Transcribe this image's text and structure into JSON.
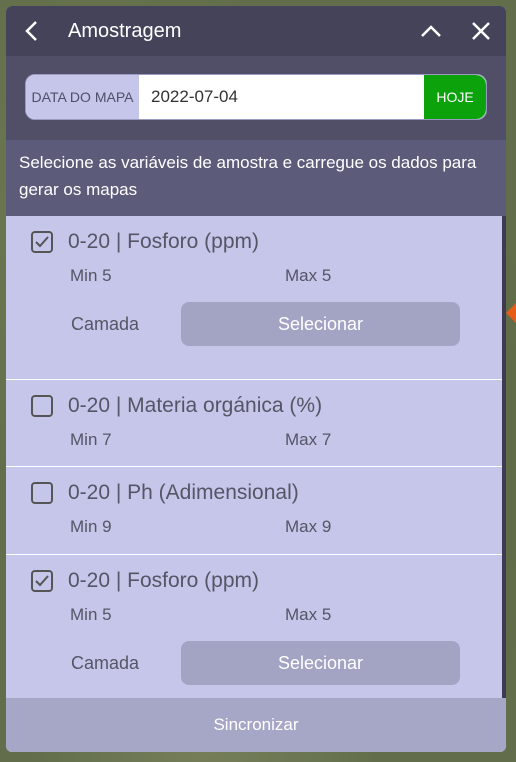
{
  "header": {
    "title": "Amostragem",
    "back_icon": "chevron-left-icon",
    "collapse_icon": "chevron-up-icon",
    "close_icon": "close-icon"
  },
  "date": {
    "label": "DATA DO MAPA",
    "value": "2022-07-04",
    "today_label": "HOJE"
  },
  "instructions": "Selecione as variáveis de amostra e carregue os dados para gerar os mapas",
  "items": [
    {
      "name": "0-20 | Fosforo (ppm)",
      "min": "Min 5",
      "max": "Max 5",
      "checked": true,
      "layer_label": "Camada",
      "select_label": "Selecionar"
    },
    {
      "name": "0-20 | Materia orgánica (%)",
      "min": "Min 7",
      "max": "Max 7",
      "checked": false
    },
    {
      "name": "0-20 | Ph (Adimensional)",
      "min": "Min 9",
      "max": "Max 9",
      "checked": false
    },
    {
      "name": "0-20 | Fosforo (ppm)",
      "min": "Min 5",
      "max": "Max 5",
      "checked": true,
      "layer_label": "Camada",
      "select_label": "Selecionar"
    }
  ],
  "footer": {
    "sync_label": "Sincronizar"
  },
  "colors": {
    "header_bg": "#44435a",
    "panel_bg": "#c6c6ea",
    "accent_green": "#0ba20b",
    "button_bg": "#a3a3c4"
  }
}
